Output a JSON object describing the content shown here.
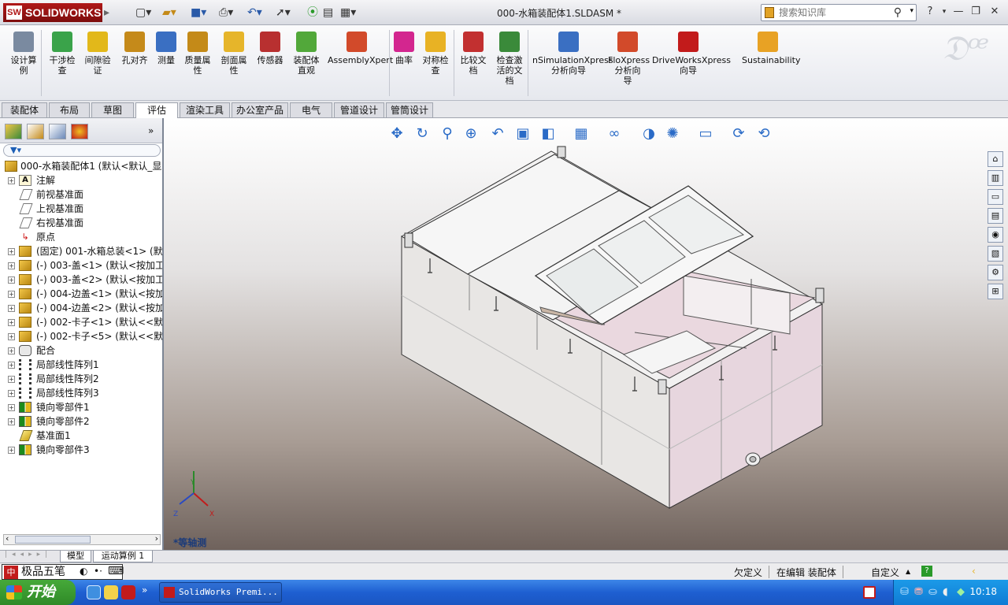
{
  "window": {
    "app_name": "SOLIDWORKS",
    "app_logo_mark": "SW",
    "doc_title": "000-水箱装配体1.SLDASM *",
    "search_placeholder": "搜索知识库",
    "help": "?"
  },
  "toolbar": {
    "tools": [
      {
        "label": "设计算\n例",
        "icon": "design-study-icon",
        "color": "#7a8aa0"
      },
      {
        "label": "干涉检\n查",
        "icon": "interference-icon",
        "color": "#3aa34a"
      },
      {
        "label": "间隙验\n证",
        "icon": "clearance-icon",
        "color": "#e2b81a"
      },
      {
        "label": "孔对齐",
        "icon": "hole-align-icon",
        "color": "#c58a1a"
      },
      {
        "label": "测量",
        "icon": "measure-icon",
        "color": "#3a6fc2"
      },
      {
        "label": "质量属\n性",
        "icon": "mass-props-icon",
        "color": "#c48a18"
      },
      {
        "label": "剖面属\n性",
        "icon": "section-props-icon",
        "color": "#e6b52a"
      },
      {
        "label": "传感器",
        "icon": "sensor-icon",
        "color": "#b83030"
      },
      {
        "label": "装配体\n直观",
        "icon": "asm-visual-icon",
        "color": "#52a83a"
      },
      {
        "label": "AssemblyXpert",
        "icon": "assemblyxpert-icon",
        "color": "#d24a2a"
      },
      {
        "label": "曲率",
        "icon": "curvature-icon",
        "color": "#d3268f"
      },
      {
        "label": "对称检\n查",
        "icon": "symmetry-icon",
        "color": "#e8b224"
      },
      {
        "label": "比较文\n档",
        "icon": "compare-icon",
        "color": "#c23030"
      },
      {
        "label": "检查激\n活的文\n档",
        "icon": "check-doc-icon",
        "color": "#3a8a3a"
      },
      {
        "label": "nSimulationXpress\n分析向导",
        "icon": "simxpress-icon",
        "color": "#3a6fc2"
      },
      {
        "label": "FloXpress\n分析向\n导",
        "icon": "floxpress-icon",
        "color": "#d24a2a"
      },
      {
        "label": "DriveWorksXpress\n向导",
        "icon": "driveworks-icon",
        "color": "#c21b1b"
      },
      {
        "label": "Sustainability",
        "icon": "sustainability-icon",
        "color": "#e8a224"
      }
    ]
  },
  "tabs": [
    "装配体",
    "布局",
    "草图",
    "评估",
    "渲染工具",
    "办公室产品",
    "电气",
    "管道设计",
    "管筒设计"
  ],
  "active_tab": "评估",
  "tree": {
    "root": "000-水箱装配体1  (默认<默认_显",
    "items": [
      {
        "label": "注解",
        "icon": "note",
        "glyph": "A",
        "expand": true
      },
      {
        "label": "前视基准面",
        "icon": "plane",
        "expand": false
      },
      {
        "label": "上视基准面",
        "icon": "plane",
        "expand": false
      },
      {
        "label": "右视基准面",
        "icon": "plane",
        "expand": false
      },
      {
        "label": "原点",
        "icon": "origin",
        "glyph": "↳",
        "expand": false
      },
      {
        "label": "(固定) 001-水箱总装<1> (默认",
        "icon": "asm",
        "expand": true
      },
      {
        "label": "(-) 003-盖<1> (默认<按加工",
        "icon": "asm",
        "expand": true
      },
      {
        "label": "(-) 003-盖<2> (默认<按加工",
        "icon": "asm",
        "expand": true
      },
      {
        "label": "(-) 004-边盖<1> (默认<按加工",
        "icon": "asm",
        "expand": true
      },
      {
        "label": "(-) 004-边盖<2> (默认<按加工",
        "icon": "asm",
        "expand": true
      },
      {
        "label": "(-) 002-卡子<1> (默认<<默认",
        "icon": "asm",
        "expand": true
      },
      {
        "label": "(-) 002-卡子<5> (默认<<默认",
        "icon": "asm",
        "expand": true
      },
      {
        "label": "配合",
        "icon": "mate",
        "expand": true
      },
      {
        "label": "局部线性阵列1",
        "icon": "pattern",
        "expand": true
      },
      {
        "label": "局部线性阵列2",
        "icon": "pattern",
        "expand": true
      },
      {
        "label": "局部线性阵列3",
        "icon": "pattern",
        "expand": true
      },
      {
        "label": "镜向零部件1",
        "icon": "mirror",
        "expand": true
      },
      {
        "label": "镜向零部件2",
        "icon": "mirror",
        "expand": true
      },
      {
        "label": "基准面1",
        "icon": "planeY",
        "expand": false
      },
      {
        "label": "镜向零部件3",
        "icon": "mirror",
        "expand": true
      }
    ]
  },
  "viewport": {
    "view_name": "*等轴测",
    "triad": {
      "x": "X",
      "y": "Y",
      "z": "Z"
    },
    "view_tools": [
      "pan-icon",
      "rotate-icon",
      "zoom-fit-icon",
      "zoom-area-icon",
      "previous-view-icon",
      "section-view-icon",
      "view-orientation-icon",
      "display-style-icon",
      "hide-show-icon",
      "edit-appearance-icon",
      "apply-scene-icon",
      "view-settings-icon",
      "rebuild-icon",
      "regen-icon"
    ]
  },
  "bottom_tabs": [
    "模型",
    "运动算例 1"
  ],
  "status": {
    "defined": "欠定义",
    "editing": "在编辑 装配体",
    "units": "自定义",
    "units_arrow": "▲"
  },
  "ime": {
    "mark": "中",
    "name": "极品五笔"
  },
  "taskbar": {
    "start": "开始",
    "task_label": "SolidWorks Premi...",
    "clock": "10:18"
  }
}
